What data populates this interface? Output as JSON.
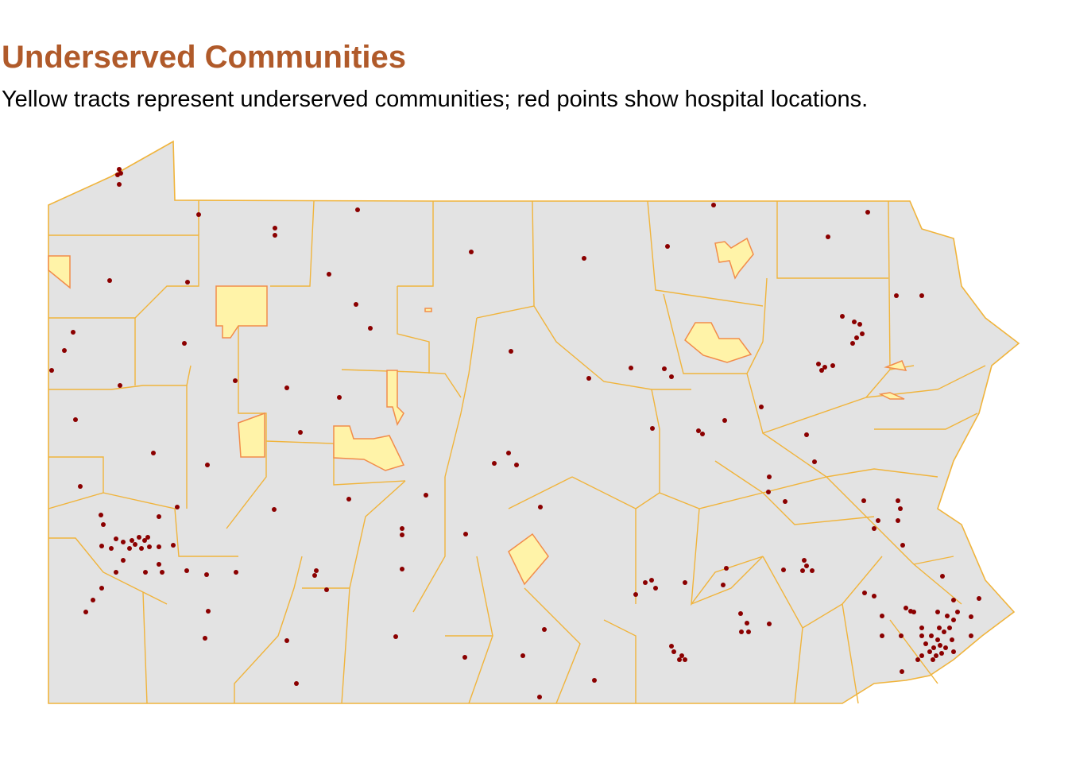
{
  "title": "Underserved Communities",
  "subtitle": "Yellow tracts represent underserved communities; red points show hospital locations.",
  "colors": {
    "title": "#b05a2a",
    "land": "#e3e3e3",
    "tract_line": "#cfcfcf",
    "county_border": "#f0b43c",
    "underserved_fill": "#fff3a8",
    "underserved_border": "#f28c4a",
    "hospital": "#8b0000"
  },
  "legend_meaning": {
    "underserved": "Yellow tracts",
    "hospital": "red points"
  }
}
